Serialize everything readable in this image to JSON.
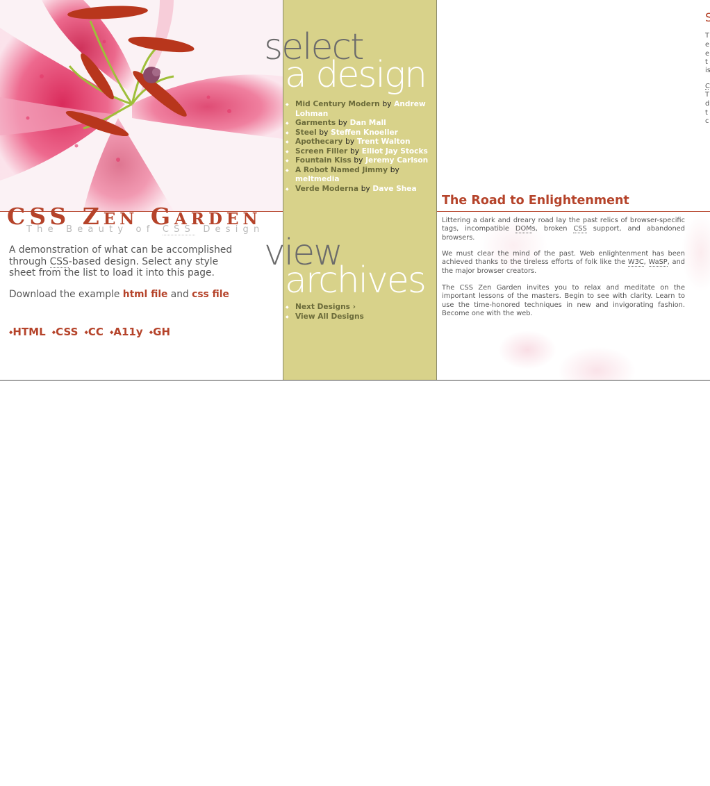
{
  "header": {
    "title": "CSS Zen Garden",
    "subtitle_pre": "The Beauty of ",
    "subtitle_abbr": "CSS",
    "subtitle_post": " Design"
  },
  "intro": {
    "part1": "A demonstration of what can be accomplished through ",
    "abbr": "CSS",
    "part2": "-based design. Select any style sheet from the list to load it into this page."
  },
  "download": {
    "prefix": "Download the example ",
    "html_label": "html file",
    "and": " and ",
    "css_label": "css file"
  },
  "footer_links": [
    "HTML",
    "CSS",
    "CC",
    "A11y",
    "GH"
  ],
  "select_heading": {
    "line1": "select",
    "line2": "a design"
  },
  "designs": [
    {
      "name": "Mid Century Modern",
      "by": "by",
      "author": "Andrew Lohman"
    },
    {
      "name": "Garments",
      "by": "by",
      "author": "Dan Mall"
    },
    {
      "name": "Steel",
      "by": "by",
      "author": "Steffen Knoeller"
    },
    {
      "name": "Apothecary",
      "by": "by",
      "author": "Trent Walton"
    },
    {
      "name": "Screen Filler",
      "by": "by",
      "author": "Elliot Jay Stocks"
    },
    {
      "name": "Fountain Kiss",
      "by": "by",
      "author": "Jeremy Carlson"
    },
    {
      "name": "A Robot Named Jimmy",
      "by": "by",
      "author": "meltmedia"
    },
    {
      "name": "Verde Moderna",
      "by": "by",
      "author": "Dave Shea"
    }
  ],
  "archives_heading": {
    "line1": "view",
    "line2": "archives"
  },
  "archives": [
    {
      "label": "Next Designs ›"
    },
    {
      "label": "View All Designs"
    }
  ],
  "road": {
    "title": "The Road to Enlightenment",
    "p1_a": "Littering a dark and dreary road lay the past relics of browser-specific tags, incompatible ",
    "p1_abbr1": "DOM",
    "p1_b": "s, broken ",
    "p1_abbr2": "CSS",
    "p1_c": " support, and abandoned browsers.",
    "p2_a": "We must clear the mind of the past. Web enlightenment has been achieved thanks to the tireless efforts of folk like the ",
    "p2_abbr1": "W3C",
    "p2_b": ", ",
    "p2_abbr2": "WaSP",
    "p2_c": ", and the major browser creators.",
    "p3": "The CSS Zen Garden invites you to relax and meditate on the important lessons of the masters. Begin to see with clarity. Learn to use the time-honored techniques in new and invigorating fashion. Become one with the web."
  },
  "clipped": {
    "title": "S",
    "lines": [
      "T",
      "e",
      "e",
      "t",
      "is",
      "",
      "C",
      "T",
      "d",
      "t",
      "c"
    ]
  },
  "colors": {
    "accent": "#b5432a",
    "middle_bg": "#d8d28a",
    "text": "#555555"
  }
}
